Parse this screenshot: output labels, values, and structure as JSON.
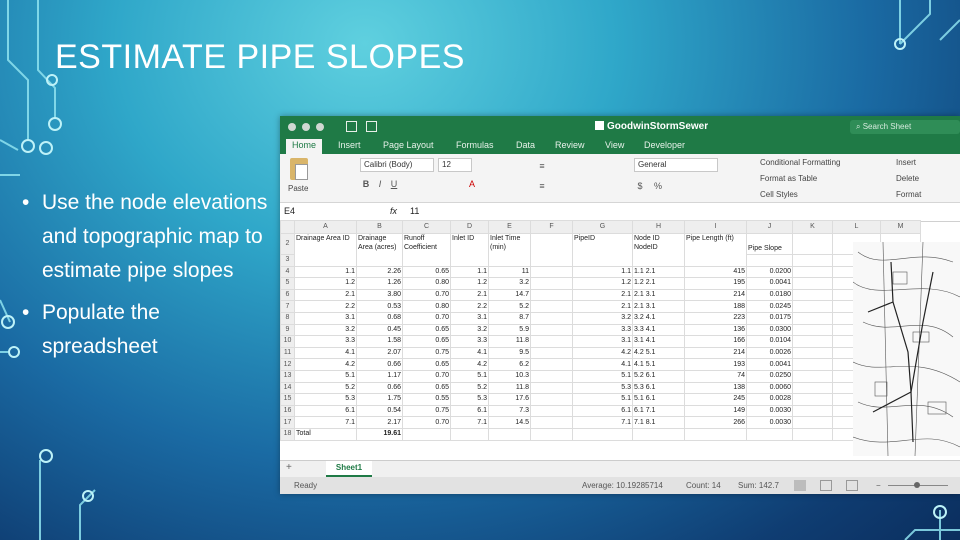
{
  "slide": {
    "title": "ESTIMATE PIPE SLOPES",
    "bullets": [
      "Use the node elevations and topographic map to estimate pipe slopes",
      "Populate the spreadsheet"
    ]
  },
  "excel": {
    "workbook": "GoodwinStormSewer",
    "search_placeholder": "Search Sheet",
    "tabs": [
      "Home",
      "Insert",
      "Page Layout",
      "Formulas",
      "Data",
      "Review",
      "View",
      "Developer"
    ],
    "ribbon": {
      "paste": "Paste",
      "font_name": "Calibri (Body)",
      "font_size": "12",
      "number_format": "General",
      "conditional_formatting": "Conditional Formatting",
      "format_as_table": "Format as Table",
      "cell_styles": "Cell Styles",
      "insert": "Insert",
      "delete": "Delete",
      "format": "Format"
    },
    "name_box": "E4",
    "fx": "fx",
    "formula_value": "11",
    "columns": [
      "A",
      "B",
      "C",
      "D",
      "E",
      "F",
      "G",
      "H",
      "I",
      "J",
      "K",
      "L",
      "M"
    ],
    "headers": {
      "drainage_area_id": "Drainage Area ID",
      "drainage_area": "Drainage Area (acres)",
      "runoff_coeff": "Runoff Coefficient",
      "inlet_id": "Inlet ID",
      "inlet_time": "Inlet Time (min)",
      "pipe_id": "PipeID",
      "node_id": "Node ID",
      "node_id2": "NodeID",
      "pipe_length": "Pipe Length (ft)",
      "pipe_slope": "Pipe Slope"
    },
    "rows": [
      {
        "r": "4",
        "a": "1.1",
        "b": "2.26",
        "c": "0.65",
        "d": "1.1",
        "e": "11",
        "g": "1.1",
        "h": "1.1",
        "h2": "2.1",
        "i": "415",
        "j": "0.0200"
      },
      {
        "r": "5",
        "a": "1.2",
        "b": "1.26",
        "c": "0.80",
        "d": "1.2",
        "e": "3.2",
        "g": "1.2",
        "h": "1.2",
        "h2": "2.1",
        "i": "195",
        "j": "0.0041"
      },
      {
        "r": "6",
        "a": "2.1",
        "b": "3.80",
        "c": "0.70",
        "d": "2.1",
        "e": "14.7",
        "g": "2.1",
        "h": "2.1",
        "h2": "3.1",
        "i": "214",
        "j": "0.0180"
      },
      {
        "r": "7",
        "a": "2.2",
        "b": "0.53",
        "c": "0.80",
        "d": "2.2",
        "e": "5.2",
        "g": "2.1",
        "h": "2.1",
        "h2": "3.1",
        "i": "188",
        "j": "0.0245"
      },
      {
        "r": "8",
        "a": "3.1",
        "b": "0.68",
        "c": "0.70",
        "d": "3.1",
        "e": "8.7",
        "g": "3.2",
        "h": "3.2",
        "h2": "4.1",
        "i": "223",
        "j": "0.0175"
      },
      {
        "r": "9",
        "a": "3.2",
        "b": "0.45",
        "c": "0.65",
        "d": "3.2",
        "e": "5.9",
        "g": "3.3",
        "h": "3.3",
        "h2": "4.1",
        "i": "136",
        "j": "0.0300"
      },
      {
        "r": "10",
        "a": "3.3",
        "b": "1.58",
        "c": "0.65",
        "d": "3.3",
        "e": "11.8",
        "g": "3.1",
        "h": "3.1",
        "h2": "4.1",
        "i": "166",
        "j": "0.0104"
      },
      {
        "r": "11",
        "a": "4.1",
        "b": "2.07",
        "c": "0.75",
        "d": "4.1",
        "e": "9.5",
        "g": "4.2",
        "h": "4.2",
        "h2": "5.1",
        "i": "214",
        "j": "0.0026"
      },
      {
        "r": "12",
        "a": "4.2",
        "b": "0.66",
        "c": "0.65",
        "d": "4.2",
        "e": "6.2",
        "g": "4.1",
        "h": "4.1",
        "h2": "5.1",
        "i": "193",
        "j": "0.0041"
      },
      {
        "r": "13",
        "a": "5.1",
        "b": "1.17",
        "c": "0.70",
        "d": "5.1",
        "e": "10.3",
        "g": "5.1",
        "h": "5.2",
        "h2": "6.1",
        "i": "74",
        "j": "0.0250"
      },
      {
        "r": "14",
        "a": "5.2",
        "b": "0.66",
        "c": "0.65",
        "d": "5.2",
        "e": "11.8",
        "g": "5.3",
        "h": "5.3",
        "h2": "6.1",
        "i": "138",
        "j": "0.0060"
      },
      {
        "r": "15",
        "a": "5.3",
        "b": "1.75",
        "c": "0.55",
        "d": "5.3",
        "e": "17.6",
        "g": "5.1",
        "h": "5.1",
        "h2": "6.1",
        "i": "245",
        "j": "0.0028"
      },
      {
        "r": "16",
        "a": "6.1",
        "b": "0.54",
        "c": "0.75",
        "d": "6.1",
        "e": "7.3",
        "g": "6.1",
        "h": "6.1",
        "h2": "7.1",
        "i": "149",
        "j": "0.0030"
      },
      {
        "r": "17",
        "a": "7.1",
        "b": "2.17",
        "c": "0.70",
        "d": "7.1",
        "e": "14.5",
        "g": "7.1",
        "h": "7.1",
        "h2": "8.1",
        "i": "266",
        "j": "0.0030"
      }
    ],
    "total_label": "Total",
    "total_value": "19.61",
    "sheet_tab": "Sheet1",
    "status": {
      "ready": "Ready",
      "average": "Average: 10.19285714",
      "count": "Count: 14",
      "sum": "Sum: 142.7"
    }
  }
}
